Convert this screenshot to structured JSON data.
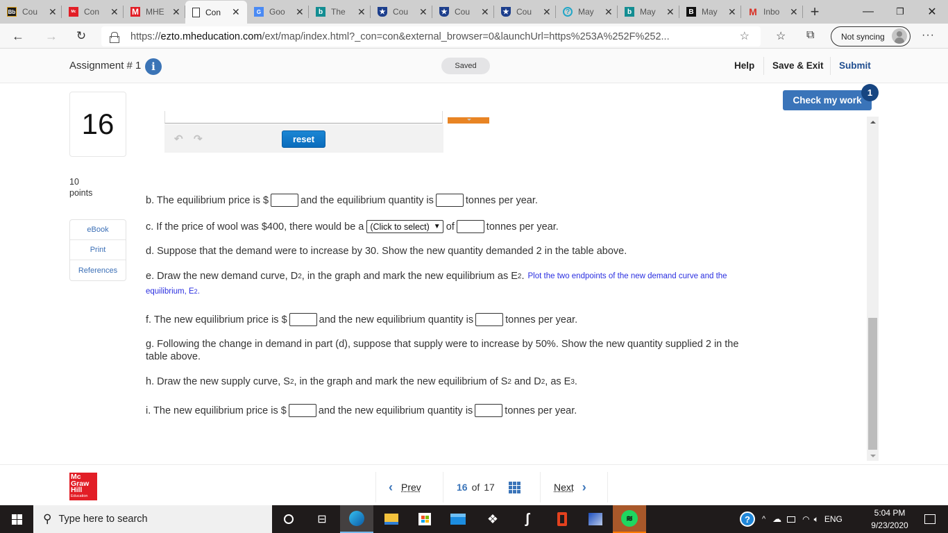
{
  "browser": {
    "tabs": [
      {
        "title": "Cou",
        "icon": "blackboard-icon",
        "color": "#1a1a1a"
      },
      {
        "title": "Con",
        "icon": "mcgraw-hill-icon",
        "color": "#e21e26"
      },
      {
        "title": "MHE",
        "icon": "mhe-m-icon",
        "color": "#e21e26"
      },
      {
        "title": "Con",
        "icon": "blank-page-icon",
        "color": "#ffffff",
        "active": true
      },
      {
        "title": "Goo",
        "icon": "google-translate-icon",
        "color": "#4a8af4"
      },
      {
        "title": "The",
        "icon": "bing-icon",
        "color": "#138d92"
      },
      {
        "title": "Cou",
        "icon": "shield-star-icon",
        "color": "#1c3e8c"
      },
      {
        "title": "Cou",
        "icon": "shield-star-icon",
        "color": "#1c3e8c"
      },
      {
        "title": "Cou",
        "icon": "shield-star-icon",
        "color": "#1c3e8c"
      },
      {
        "title": "May",
        "icon": "help-circle-icon",
        "color": "#22a6c7"
      },
      {
        "title": "May",
        "icon": "bing-icon",
        "color": "#138d92"
      },
      {
        "title": "May",
        "icon": "brainly-icon",
        "color": "#111111"
      },
      {
        "title": "Inbo",
        "icon": "gmail-icon",
        "color": "#d93025"
      }
    ],
    "new_tab": "+",
    "url_prefix": "https://",
    "url_host": "ezto.mheducation.com",
    "url_path": "/ext/map/index.html?_con=con&external_browser=0&launchUrl=https%253A%252F%252...",
    "sync_label": "Not syncing"
  },
  "header": {
    "title": "Assignment # 1",
    "info_glyph": "i",
    "saved_label": "Saved",
    "help_label": "Help",
    "save_exit_label": "Save & Exit",
    "submit_label": "Submit"
  },
  "question": {
    "number": "16",
    "points_value": "10",
    "points_label": "points",
    "side_links": [
      "eBook",
      "Print",
      "References"
    ],
    "reset_label": "reset",
    "check_label": "Check my work",
    "check_badge": "1",
    "parts": {
      "b": {
        "t1": "b. The equilibrium price is $",
        "t2": "and the equilibrium quantity is",
        "t3": "tonnes per year."
      },
      "c": {
        "t1": "c. If the price of wool was $400, there would be a",
        "select": "(Click to select)",
        "t2": "of",
        "t3": "tonnes per year."
      },
      "d": {
        "t1": "d. Suppose that the demand were to increase by 30. Show the new quantity demanded 2 in the table above."
      },
      "e": {
        "t1": "e. Draw the new demand curve, D",
        "sub1": "2",
        "t2": ", in the graph and mark the new equilibrium as E",
        "sub2": "2",
        "t3": ".",
        "hint1": "Plot the two endpoints of the new demand curve and the",
        "hint2": "equilibrium, E",
        "hint_sub": "2",
        "hint_end": "."
      },
      "f": {
        "t1": "f. The new equilibrium price is $",
        "t2": "and the new equilibrium quantity is",
        "t3": "tonnes per year."
      },
      "g": {
        "line1": "g. Following the change in demand in part (d), suppose that supply were to increase by 50%. Show the new quantity supplied 2 in the",
        "line2": "table above."
      },
      "h": {
        "t1": "h. Draw the new supply curve, S",
        "sub1": "2",
        "t2": ", in the graph and mark the new equilibrium of S",
        "sub2": "2",
        "t3": " and D",
        "sub3": "2",
        "t4": ", as E",
        "sub4": "3",
        "t5": "."
      },
      "i": {
        "t1": "i. The new equilibrium price is $",
        "t2": "and the new equilibrium quantity is",
        "t3": "tonnes per year."
      }
    }
  },
  "footer": {
    "logo_lines": [
      "Mc",
      "Graw",
      "Hill",
      "Education"
    ],
    "prev_label": "Prev",
    "current_page": "16",
    "of_label": "of",
    "total_pages": "17",
    "next_label": "Next"
  },
  "taskbar": {
    "search_placeholder": "Type here to search",
    "language": "ENG",
    "time": "5:04 PM",
    "date": "9/23/2020"
  }
}
